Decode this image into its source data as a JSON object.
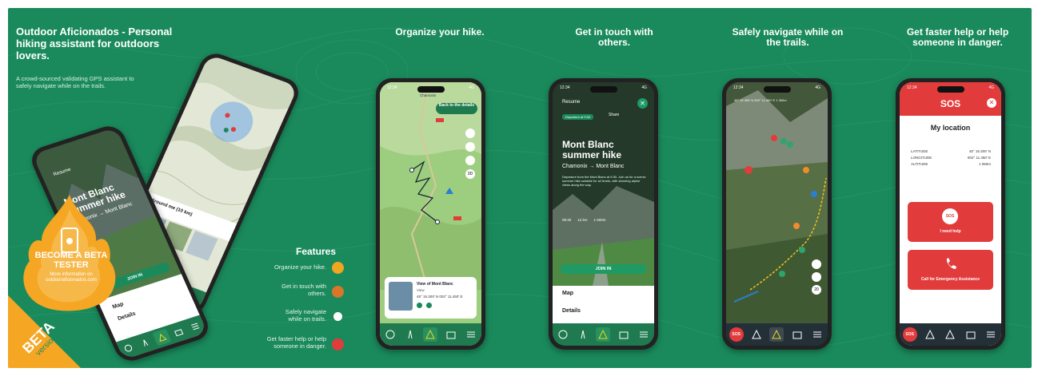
{
  "intro": {
    "title": "Outdoor Aficionados - Personal hiking assistant for outdoors lovers.",
    "description": "A crowd-sourced validating GPS assistant to safely navigate while on the trails."
  },
  "badge": {
    "beta": "BETA",
    "version": "version",
    "flame_title": "BECOME A BETA TESTER",
    "flame_sub": "More information on outdooraficionados.com"
  },
  "features": {
    "title": "Features",
    "items": [
      {
        "label": "Organize your hike.",
        "color": "#f2a51e"
      },
      {
        "label": "Get in touch with others.",
        "color": "#d9762a"
      },
      {
        "label": "Safely navigate while on trails.",
        "color": "#1a8a5c"
      },
      {
        "label": "Get faster help or help someone in danger.",
        "color": "#e23b3b"
      }
    ]
  },
  "headings": [
    "Organize your hike.",
    "Get in touch with others.",
    "Safely navigate while on the trails.",
    "Get faster help or help someone in danger."
  ],
  "phone_common": {
    "time": "12:34",
    "signal": "4G"
  },
  "tabs_main": [
    "MY ACCOUNT",
    "MY TRAILS",
    "GUIDE",
    "EMERGENCY GUIDE",
    "MENU"
  ],
  "tabs_nav": [
    "S.O.S",
    "WARNING",
    "EXIT",
    "EMERGENCY GUIDE",
    "MENU"
  ],
  "phone_organize": {
    "back": "Back to the details",
    "place": "Chamonix",
    "card_title": "View of Mont Blanc",
    "card_sub": "View",
    "card_coords": "45° 15.300' N   002° 11.450' E"
  },
  "phone_touch": {
    "resume": "Resume",
    "share": "Share",
    "tag": "Departure at 9:30",
    "title": "Mont Blanc summer hike",
    "route": "Chamonix → Mont Blanc",
    "body": "Departure from the Mont Blanc at 9:30. Join us for a scenic summer hike suitable for all levels, with stunning alpine views along the way.",
    "join": "JOIN IN",
    "map": "Map",
    "details": "Details",
    "stat1": "09:30",
    "stat2": "12 km",
    "stat3": "1 600m"
  },
  "phone_nav": {
    "coords": "45° 15.300' N   002° 11.450' E   1 300m",
    "zoom": "20"
  },
  "phone_sos": {
    "title": "SOS",
    "location_title": "My location",
    "rows": [
      {
        "label": "LATITUDE",
        "value": "45° 15.300' N"
      },
      {
        "label": "LONGITUDE",
        "value": "002° 11.450' E"
      },
      {
        "label": "ALTITUDE",
        "value": "1 050m"
      }
    ],
    "need_help": "I need help",
    "call": "Call for Emergency Assistance",
    "sos_badge": "SOS"
  },
  "tilted_front": {
    "resume": "Resume",
    "title": "Mont Blanc summer hike",
    "route": "Chamonix → Mont Blanc",
    "join": "JOIN IN",
    "map": "Map",
    "details": "Details"
  },
  "tilted_back": {
    "around": "Around me (10 km)"
  },
  "colors": {
    "bg": "#1a8a5c",
    "dark_green": "#1f7a4f",
    "sos_red": "#e23b3b",
    "flame": "#f5a623"
  }
}
